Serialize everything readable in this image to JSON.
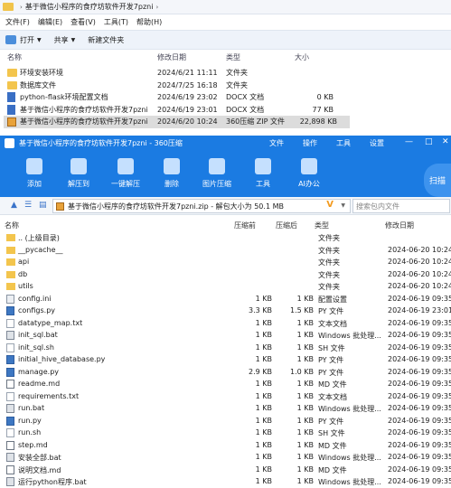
{
  "explorer": {
    "breadcrumb": [
      "基于微信小程序的食疗坊软件开发7pzni"
    ],
    "menu": [
      "文件(F)",
      "编辑(E)",
      "查看(V)",
      "工具(T)",
      "帮助(H)"
    ],
    "toolbar": {
      "open": "打开",
      "share": "共享",
      "new_folder": "新建文件夹"
    },
    "columns": {
      "name": "名称",
      "modified": "修改日期",
      "type": "类型",
      "size": "大小"
    },
    "files": [
      {
        "name": "环境安装环境",
        "modified": "2024/6/21 11:11",
        "type": "文件夹",
        "size": "",
        "icon": "folder-icon"
      },
      {
        "name": "数据库文件",
        "modified": "2024/7/25 16:18",
        "type": "文件夹",
        "size": "",
        "icon": "folder-icon"
      },
      {
        "name": "python-flask环境配置文档",
        "modified": "2024/6/19 23:02",
        "type": "DOCX 文档",
        "size": "0 KB",
        "icon": "docx-icon"
      },
      {
        "name": "基于微信小程序的食疗坊软件开发7pzni",
        "modified": "2024/6/19 23:01",
        "type": "DOCX 文档",
        "size": "77 KB",
        "icon": "docx-icon"
      },
      {
        "name": "基于微信小程序的食疗坊软件开发7pzni",
        "modified": "2024/6/20 10:24",
        "type": "360压缩 ZIP 文件",
        "size": "22,898 KB",
        "icon": "zip-icon"
      }
    ]
  },
  "zip": {
    "title": "基于微信小程序的食疗坊软件开发7pzni - 360压缩",
    "menus": [
      "文件",
      "操作",
      "工具",
      "设置"
    ],
    "tools": [
      {
        "label": "添加",
        "icon": "add-icon"
      },
      {
        "label": "解压到",
        "icon": "extract-to-icon"
      },
      {
        "label": "一键解压",
        "icon": "one-click-extract-icon"
      },
      {
        "label": "删除",
        "icon": "delete-icon"
      },
      {
        "label": "图片压缩",
        "icon": "image-compress-icon"
      },
      {
        "label": "工具",
        "icon": "tools-icon"
      },
      {
        "label": "AI办公",
        "icon": "ai-icon"
      }
    ],
    "scan_label": "扫描",
    "address": "基于微信小程序的食疗坊软件开发7pzni.zip - 解包大小为 50.1 MB",
    "search_placeholder": "搜索包内文件",
    "columns": {
      "name": "名称",
      "compressed": "压缩前",
      "size": "压缩后",
      "type": "类型",
      "modified": "修改日期"
    },
    "entries": [
      {
        "name": ".. (上级目录)",
        "compressed": "",
        "size": "",
        "type": "文件夹",
        "modified": "",
        "icon": "folder-icon"
      },
      {
        "name": "__pycache__",
        "compressed": "",
        "size": "",
        "type": "文件夹",
        "modified": "2024-06-20 10:24",
        "icon": "folder-icon"
      },
      {
        "name": "api",
        "compressed": "",
        "size": "",
        "type": "文件夹",
        "modified": "2024-06-20 10:24",
        "icon": "folder-icon"
      },
      {
        "name": "db",
        "compressed": "",
        "size": "",
        "type": "文件夹",
        "modified": "2024-06-20 10:24",
        "icon": "folder-icon"
      },
      {
        "name": "utils",
        "compressed": "",
        "size": "",
        "type": "文件夹",
        "modified": "2024-06-20 10:24",
        "icon": "folder-icon"
      },
      {
        "name": "config.ini",
        "compressed": "1 KB",
        "size": "1 KB",
        "type": "配置设置",
        "modified": "2024-06-19 09:35",
        "icon": "config-file-icon"
      },
      {
        "name": "configs.py",
        "compressed": "3.3 KB",
        "size": "1.5 KB",
        "type": "PY 文件",
        "modified": "2024-06-19 23:01",
        "icon": "python-file-icon"
      },
      {
        "name": "datatype_map.txt",
        "compressed": "1 KB",
        "size": "1 KB",
        "type": "文本文档",
        "modified": "2024-06-19 09:35",
        "icon": "text-file-icon"
      },
      {
        "name": "init_sql.bat",
        "compressed": "1 KB",
        "size": "1 KB",
        "type": "Windows 批处理...",
        "modified": "2024-06-19 09:35",
        "icon": "batch-file-icon"
      },
      {
        "name": "init_sql.sh",
        "compressed": "1 KB",
        "size": "1 KB",
        "type": "SH 文件",
        "modified": "2024-06-19 09:35",
        "icon": "file-icon"
      },
      {
        "name": "initial_hive_database.py",
        "compressed": "1 KB",
        "size": "1 KB",
        "type": "PY 文件",
        "modified": "2024-06-19 09:35",
        "icon": "python-file-icon"
      },
      {
        "name": "manage.py",
        "compressed": "2.9 KB",
        "size": "1.0 KB",
        "type": "PY 文件",
        "modified": "2024-06-19 09:35",
        "icon": "python-file-icon"
      },
      {
        "name": "readme.md",
        "compressed": "1 KB",
        "size": "1 KB",
        "type": "MD 文件",
        "modified": "2024-06-19 09:35",
        "icon": "markdown-file-icon"
      },
      {
        "name": "requirements.txt",
        "compressed": "1 KB",
        "size": "1 KB",
        "type": "文本文档",
        "modified": "2024-06-19 09:35",
        "icon": "text-file-icon"
      },
      {
        "name": "run.bat",
        "compressed": "1 KB",
        "size": "1 KB",
        "type": "Windows 批处理...",
        "modified": "2024-06-19 09:35",
        "icon": "batch-file-icon"
      },
      {
        "name": "run.py",
        "compressed": "1 KB",
        "size": "1 KB",
        "type": "PY 文件",
        "modified": "2024-06-19 09:35",
        "icon": "python-file-icon"
      },
      {
        "name": "run.sh",
        "compressed": "1 KB",
        "size": "1 KB",
        "type": "SH 文件",
        "modified": "2024-06-19 09:35",
        "icon": "file-icon"
      },
      {
        "name": "step.md",
        "compressed": "1 KB",
        "size": "1 KB",
        "type": "MD 文件",
        "modified": "2024-06-19 09:35",
        "icon": "markdown-file-icon"
      },
      {
        "name": "安装全部.bat",
        "compressed": "1 KB",
        "size": "1 KB",
        "type": "Windows 批处理...",
        "modified": "2024-06-19 09:35",
        "icon": "batch-file-icon"
      },
      {
        "name": "说明文档.md",
        "compressed": "1 KB",
        "size": "1 KB",
        "type": "MD 文件",
        "modified": "2024-06-19 09:35",
        "icon": "markdown-file-icon"
      },
      {
        "name": "运行python程序.bat",
        "compressed": "1 KB",
        "size": "1 KB",
        "type": "Windows 批处理...",
        "modified": "2024-06-19 09:35",
        "icon": "batch-file-icon"
      }
    ]
  }
}
